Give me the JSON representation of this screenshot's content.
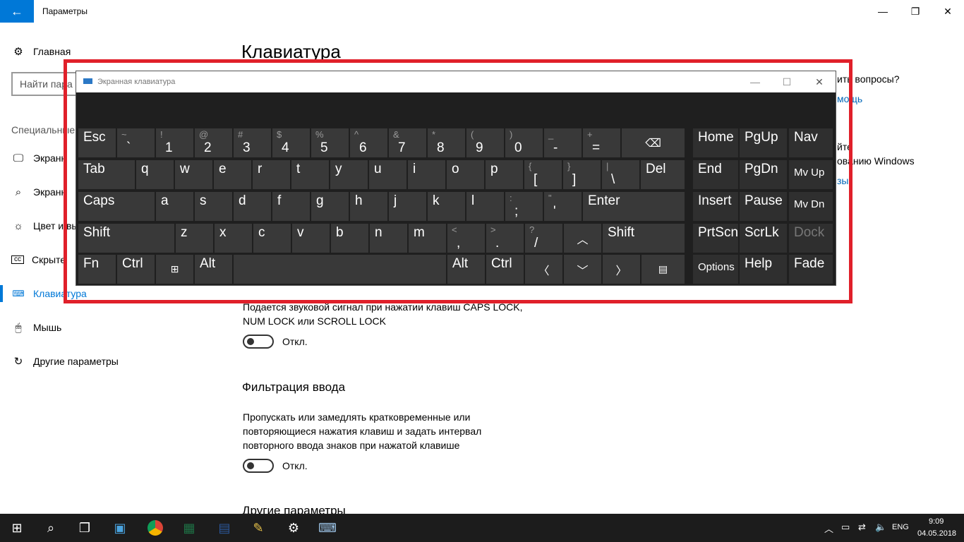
{
  "window": {
    "title": "Параметры",
    "back_icon": "arrow-left-icon",
    "minimize": "—",
    "maximize": "❐",
    "close": "✕"
  },
  "sidebar": {
    "home_label": "Главная",
    "search_placeholder": "Найти пара",
    "section_label": "Специальные",
    "items": [
      {
        "label": "Экранн",
        "icon": "display-icon"
      },
      {
        "label": "Экранн",
        "icon": "magnifier-icon"
      },
      {
        "label": "Цвет и вы",
        "icon": "brightness-icon"
      },
      {
        "label": "Скрыте",
        "icon": "captions-icon"
      },
      {
        "label": "Клавиатура",
        "icon": "keyboard-icon",
        "active": true
      },
      {
        "label": "Мышь",
        "icon": "mouse-icon"
      },
      {
        "label": "Другие параметры",
        "icon": "refresh-icon"
      }
    ]
  },
  "main": {
    "page_title": "Клавиатура",
    "sound_text_1": "Подается звуковой сигнал при нажатии клавиш CAPS LOCK,",
    "sound_text_2": "NUM LOCK или SCROLL LOCK",
    "toggle1_state": "Откл.",
    "filter_heading": "Фильтрация ввода",
    "filter_text_1": "Пропускать или замедлять кратковременные или",
    "filter_text_2": "повторяющиеся нажатия клавиш и задать интервал",
    "filter_text_3": "повторного ввода знаков при нажатой клавише",
    "toggle2_state": "Откл.",
    "other_heading": "Другие параметры"
  },
  "right_panel": {
    "questions": "ить вопросы?",
    "help_link": "мощь",
    "improve_1": "йте",
    "improve_2": "ованию Windows",
    "feedback_link": "зы"
  },
  "osk": {
    "title": "Экранная клавиатура",
    "minimize": "—",
    "maximize": "☐",
    "close": "✕",
    "keys": {
      "esc": "Esc",
      "tab": "Tab",
      "caps": "Caps",
      "shift": "Shift",
      "fn": "Fn",
      "ctrl": "Ctrl",
      "alt": "Alt",
      "del": "Del",
      "enter": "Enter",
      "shift_r": "Shift",
      "alt_r": "Alt",
      "ctrl_r": "Ctrl",
      "home": "Home",
      "pgup": "PgUp",
      "nav": "Nav",
      "end": "End",
      "pgdn": "PgDn",
      "mvup": "Mv Up",
      "insert": "Insert",
      "pause": "Pause",
      "mvdn": "Mv Dn",
      "prtscn": "PrtScn",
      "scrlk": "ScrLk",
      "dock": "Dock",
      "options": "Options",
      "help": "Help",
      "fade": "Fade",
      "backspace_icon": "⌫",
      "win_icon": "⊞",
      "menu_icon": "▤",
      "arrow_up": "︿",
      "arrow_down": "﹀",
      "arrow_left": "〈",
      "arrow_right": "〉"
    },
    "row1": [
      {
        "sym": "~",
        "low": "`"
      },
      {
        "sym": "!",
        "low": "1"
      },
      {
        "sym": "@",
        "low": "2"
      },
      {
        "sym": "#",
        "low": "3"
      },
      {
        "sym": "$",
        "low": "4"
      },
      {
        "sym": "%",
        "low": "5"
      },
      {
        "sym": "^",
        "low": "6"
      },
      {
        "sym": "&",
        "low": "7"
      },
      {
        "sym": "*",
        "low": "8"
      },
      {
        "sym": "(",
        "low": "9"
      },
      {
        "sym": ")",
        "low": "0"
      },
      {
        "sym": "_",
        "low": "-"
      },
      {
        "sym": "+",
        "low": "="
      }
    ],
    "row2": [
      "q",
      "w",
      "e",
      "r",
      "t",
      "y",
      "u",
      "i",
      "o",
      "p"
    ],
    "row2_sym": [
      {
        "sym": "{",
        "low": "["
      },
      {
        "sym": "}",
        "low": "]"
      },
      {
        "sym": "|",
        "low": "\\"
      }
    ],
    "row3": [
      "a",
      "s",
      "d",
      "f",
      "g",
      "h",
      "j",
      "k",
      "l"
    ],
    "row3_sym": [
      {
        "sym": ":",
        "low": ";"
      },
      {
        "sym": "\"",
        "low": "'"
      }
    ],
    "row4": [
      "z",
      "x",
      "c",
      "v",
      "b",
      "n",
      "m"
    ],
    "row4_sym": [
      {
        "sym": "<",
        "low": ","
      },
      {
        "sym": ">",
        "low": "."
      },
      {
        "sym": "?",
        "low": "/"
      }
    ]
  },
  "taskbar": {
    "icons": [
      "windows-start-icon",
      "search-icon",
      "task-view-icon",
      "app-icon",
      "chrome-icon",
      "excel-icon",
      "word-icon",
      "paint-icon",
      "settings-gear-icon",
      "osk-icon"
    ],
    "lang": "ENG",
    "time": "9:09",
    "date": "04.05.2018"
  }
}
